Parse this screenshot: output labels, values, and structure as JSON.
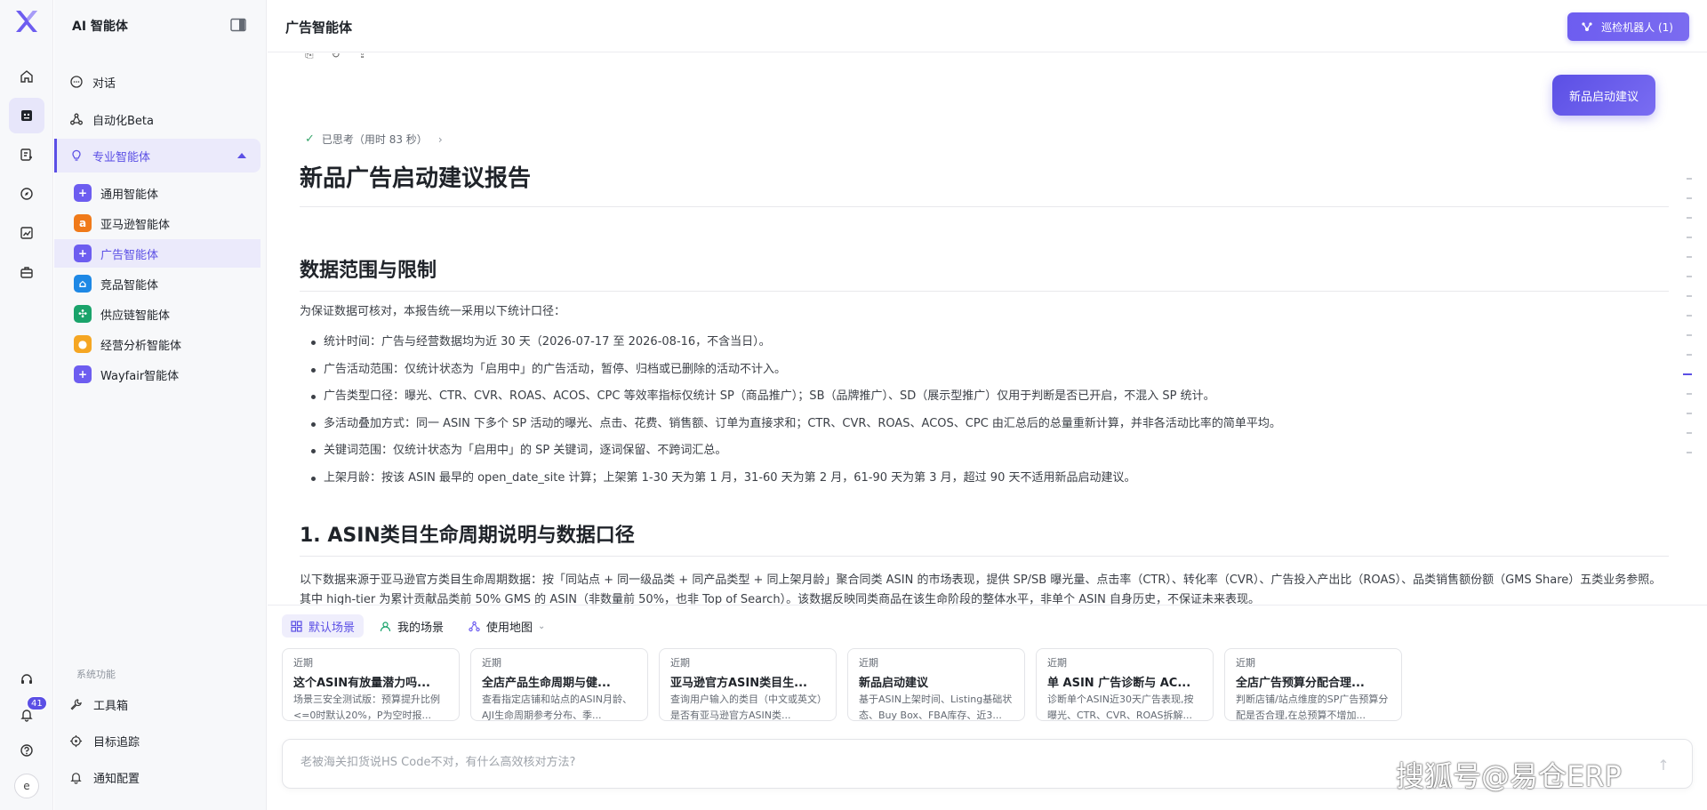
{
  "app": {
    "title": "AI 智能体",
    "header_title": "广告智能体",
    "patrol_button": "巡检机器人 (1)",
    "notification_count": "41",
    "avatar_letter": "e"
  },
  "sidebar": {
    "items": [
      {
        "label": "对话",
        "icon": "chat-icon"
      },
      {
        "label": "自动化Beta",
        "icon": "automation-icon"
      },
      {
        "label": "专业智能体",
        "icon": "bulb-icon"
      }
    ],
    "sub_items": [
      {
        "label": "通用智能体",
        "icon_text": "+",
        "color": "#6d5df0"
      },
      {
        "label": "亚马逊智能体",
        "icon_text": "a",
        "color": "#f07a1a"
      },
      {
        "label": "广告智能体",
        "icon_text": "+",
        "color": "#6d5df0"
      },
      {
        "label": "竞品智能体",
        "icon_text": "⌂",
        "color": "#1e88e5"
      },
      {
        "label": "供应链智能体",
        "icon_text": "✣",
        "color": "#1aa36b"
      },
      {
        "label": "经营分析智能体",
        "icon_text": "●",
        "color": "#f5a623"
      },
      {
        "label": "Wayfair智能体",
        "icon_text": "+",
        "color": "#6d5df0"
      }
    ],
    "system_label": "系统功能",
    "system_items": [
      {
        "label": "工具箱"
      },
      {
        "label": "目标追踪"
      },
      {
        "label": "通知配置"
      }
    ]
  },
  "content": {
    "suggest_button": "新品启动建议",
    "thought": "已思考（用时 83 秒）",
    "report_title": "新品广告启动建议报告",
    "section1_title": "数据范围与限制",
    "section1_intro": "为保证数据可核对，本报告统一采用以下统计口径：",
    "section1_bullets": [
      "统计时间：广告与经营数据均为近 30 天（2026-07-17 至 2026-08-16，不含当日）。",
      "广告活动范围：仅统计状态为「启用中」的广告活动，暂停、归档或已删除的活动不计入。",
      "广告类型口径：曝光、CTR、CVR、ROAS、ACOS、CPC 等效率指标仅统计 SP（商品推广）；SB（品牌推广）、SD（展示型推广）仅用于判断是否已开启，不混入 SP 统计。",
      "多活动叠加方式：同一 ASIN 下多个 SP 活动的曝光、点击、花费、销售额、订单为直接求和；CTR、CVR、ROAS、ACOS、CPC 由汇总后的总量重新计算，并非各活动比率的简单平均。",
      "关键词范围：仅统计状态为「启用中」的 SP 关键词，逐词保留、不跨词汇总。",
      "上架月龄：按该 ASIN 最早的 open_date_site 计算；上架第 1-30 天为第 1 月，31-60 天为第 2 月，61-90 天为第 3 月，超过 90 天不适用新品启动建议。"
    ],
    "section2_title": "1. ASIN类目生命周期说明与数据口径",
    "section2_para": "以下数据来源于亚马逊官方类目生命周期数据：按「同站点 + 同一级品类 + 同产品类型 + 同上架月龄」聚合同类 ASIN 的市场表现，提供 SP/SB 曝光量、点击率（CTR）、转化率（CVR）、广告投入产出比（ROAS）、品类销售额份额（GMS Share）五类业务参照。其中 high-tier 为累计贡献品类前 50% GMS 的 ASIN（非数量前 50%，也非 Top of Search）。该数据反映同类商品在该生命阶段的整体水平，非单个 ASIN 自身历史，不保证未来表现。"
  },
  "bottom": {
    "tabs": [
      {
        "label": "默认场景"
      },
      {
        "label": "我的场景"
      },
      {
        "label": "使用地图"
      }
    ],
    "cards": [
      {
        "tag": "近期",
        "title": "这个ASIN有放量潜力吗...",
        "desc": "场景三安全测试版：预算提升比例<=0时默认20%，P为空时报..."
      },
      {
        "tag": "近期",
        "title": "全店产品生命周期与健...",
        "desc": "查看指定店铺和站点的ASIN月龄、AJI生命周期参考分布、季..."
      },
      {
        "tag": "近期",
        "title": "亚马逊官方ASIN类目生...",
        "desc": "查询用户输入的类目（中文或英文）是否有亚马逊官方ASIN类..."
      },
      {
        "tag": "近期",
        "title": "新品启动建议",
        "desc": "基于ASIN上架时间、Listing基础状态、Buy Box、FBA库存、近3..."
      },
      {
        "tag": "近期",
        "title": "单 ASIN 广告诊断与 AC...",
        "desc": "诊断单个ASIN近30天广告表现,按曝光、CTR、CVR、ROAS拆解..."
      },
      {
        "tag": "近期",
        "title": "全店广告预算分配合理...",
        "desc": "判断店铺/站点维度的SP广告预算分配是否合理,在总预算不增加..."
      }
    ],
    "input_placeholder": "老被海关扣货说HS Code不对，有什么高效核对方法?"
  },
  "watermark": "搜狐号@易仓ERP"
}
